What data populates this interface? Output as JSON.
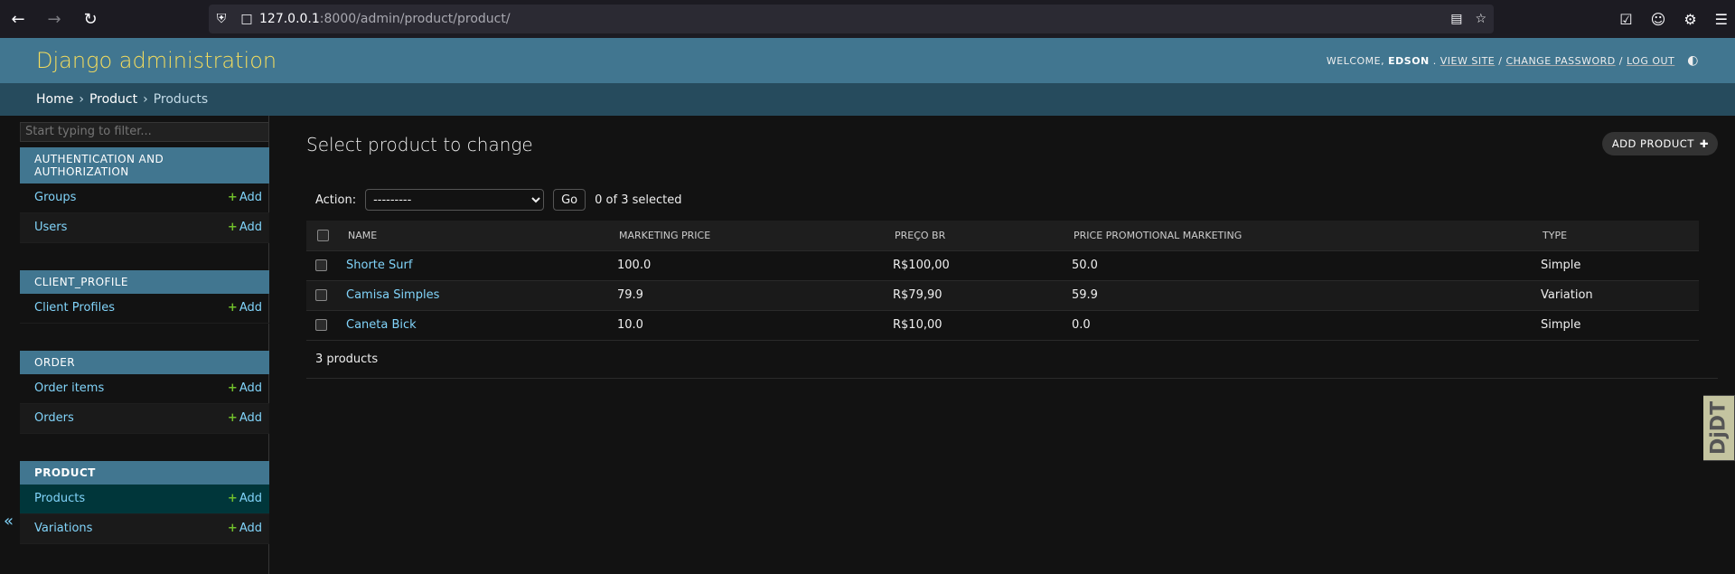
{
  "browser": {
    "url_host": "127.0.0.1",
    "url_rest": ":8000/admin/product/product/"
  },
  "header": {
    "branding": "Django administration",
    "welcome": "WELCOME,",
    "username": "EDSON",
    "view_site": "VIEW SITE",
    "change_password": "CHANGE PASSWORD",
    "log_out": "LOG OUT"
  },
  "breadcrumbs": [
    "Home",
    "Product",
    "Products"
  ],
  "sidebar": {
    "filter_placeholder": "Start typing to filter...",
    "collapse_icon": "«",
    "add_label": "Add",
    "modules": [
      {
        "caption": "AUTHENTICATION AND AUTHORIZATION",
        "items": [
          "Groups",
          "Users"
        ]
      },
      {
        "caption": "CLIENT_PROFILE",
        "items": [
          "Client Profiles"
        ]
      },
      {
        "caption": "ORDER",
        "items": [
          "Order items",
          "Orders"
        ]
      },
      {
        "caption": "PRODUCT",
        "items": [
          "Products",
          "Variations"
        ]
      }
    ]
  },
  "content": {
    "title": "Select product to change",
    "add_button": "ADD PRODUCT",
    "action_label": "Action:",
    "action_selected": "---------",
    "go_label": "Go",
    "selected_count": "0 of 3 selected",
    "columns": [
      "NAME",
      "MARKETING PRICE",
      "PREÇO BR",
      "PRICE PROMOTIONAL MARKETING",
      "TYPE"
    ],
    "rows": [
      {
        "name": "Shorte Surf",
        "marketing_price": "100.0",
        "preco_br": "R$100,00",
        "promo": "50.0",
        "type": "Simple"
      },
      {
        "name": "Camisa Simples",
        "marketing_price": "79.9",
        "preco_br": "R$79,90",
        "promo": "59.9",
        "type": "Variation"
      },
      {
        "name": "Caneta Bick",
        "marketing_price": "10.0",
        "preco_br": "R$10,00",
        "promo": "0.0",
        "type": "Simple"
      }
    ],
    "paginator": "3 products"
  },
  "djdt_label": "DjDT",
  "colors": {
    "header_bg": "#417690",
    "branding": "#f5dd5d",
    "breadcrumbs_bg": "#264b5d",
    "link": "#81d4fa",
    "add_green": "#70bf2b"
  }
}
